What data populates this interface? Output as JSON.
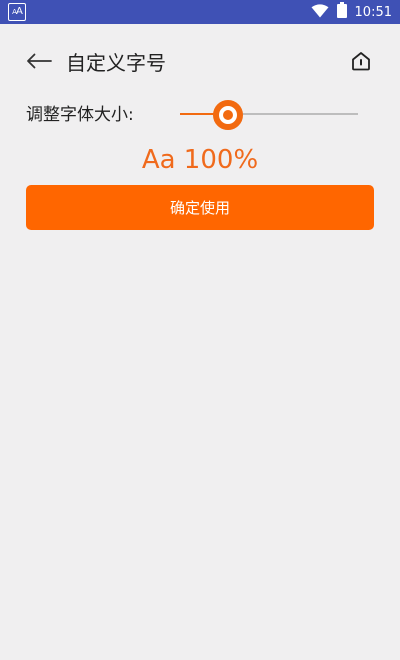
{
  "status_bar": {
    "app_icon_text": "AA",
    "time": "10:51",
    "wifi_icon": "wifi-icon",
    "battery_icon": "battery-icon",
    "background_color": "#3f51b5"
  },
  "header": {
    "back_icon": "arrow-left-icon",
    "title": "自定义字号",
    "home_icon": "home-icon"
  },
  "font_size": {
    "label": "调整字体大小:",
    "slider_value": 0.27,
    "preview_text": "Aa 100%"
  },
  "confirm_button": {
    "label": "确定使用"
  },
  "colors": {
    "accent": "#f26a10",
    "button": "#ff6600",
    "page_background": "#f0eff0"
  }
}
